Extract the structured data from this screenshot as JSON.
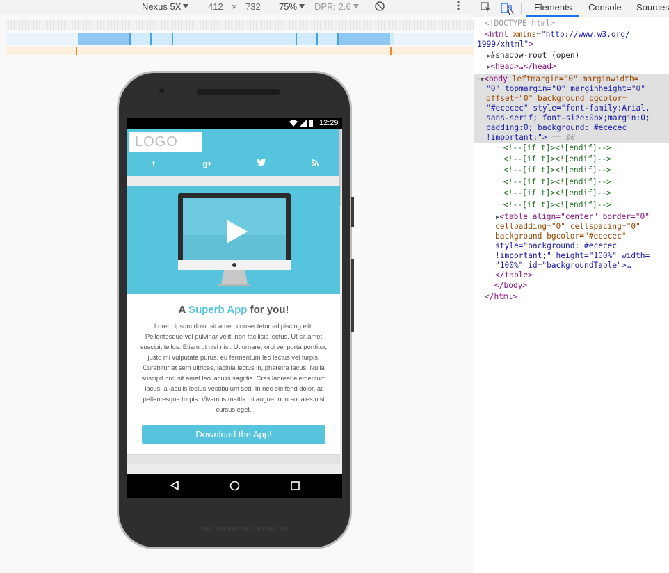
{
  "emulator": {
    "device": "Nexus 5X",
    "width": "412",
    "times": "×",
    "height": "732",
    "zoom": "75%",
    "dpr": "DPR: 2.6"
  },
  "phone": {
    "status_time": "12:29",
    "logo": "LOGO",
    "social": [
      "f",
      "g+",
      "twitter",
      "rss"
    ],
    "headline_pre": "A ",
    "headline_accent": "Superb App",
    "headline_post": " for you!",
    "body_text": "Lorem ipsum dolor sit amet, consectetur adipiscing elit. Pellentesque vel pulvinar velit, non facilisis lectus. Ut sit amet suscipit tellus. Etiam ut nisl nisl. Ut ornare, orci vel porta porttitor, justo mi vulputate purus, eu fermentum leo lectus vel turpis. Curabitur et sem ultrices, lacinia lectus in, pharetra lacus. Nulla suscipit orci sit amet leo iaculis sagittis. Cras laoreet elementum lacus, a iaculis lectus vestibulum sed. In nec eleifend dolor, at pellentesque turpis. Vivamus mattis mi augue, non sodales nisi cursus eget.",
    "cta": "Download the App!"
  },
  "devtools": {
    "tabs": [
      "Elements",
      "Console",
      "Sources"
    ],
    "active_tab": "Elements"
  },
  "tree": {
    "doctype": "<!DOCTYPE html>",
    "html_open": "<html",
    "xmlns_attr": "xmlns",
    "xmlns_val": "\"http://www.w3.org/",
    "xmlns_val2": "1999/xhtml\"",
    "shadow_root": "#shadow-root (open)",
    "head": "<head>…</head>",
    "body_tag": "<body",
    "body_l1_attrs": "leftmargin=\"0\" marginwidth=",
    "body_l2": "\"0\" topmargin=\"0\" marginheight=\"0\"",
    "body_l3": "offset=\"0\" background bgcolor=",
    "body_l4": "\"#ececec\" style=\"font-family:Arial,",
    "body_l5": "sans-serif; font-size:0px;margin:0;",
    "body_l6": "padding:0; background: #ececec",
    "body_l7": "!important;\">",
    "eq_dollar": " == $0",
    "comment": "<!--[if t]><![endif]-->",
    "table_l1": "<table align=\"center\" border=\"0\"",
    "table_l2": "cellpadding=\"0\" cellspacing=\"0\"",
    "table_l3": "background bgcolor=\"#ececec\"",
    "table_l4": "style=\"background: #ececec",
    "table_l5": "!important;\" height=\"100%\" width=",
    "table_l6": "\"100%\" id=\"backgroundTable\">…",
    "table_close": "</table>",
    "body_close": "</body>",
    "html_close": "</html>"
  },
  "colors": {
    "brand": "#56c4dc",
    "email_bg": "#ececec",
    "devtools_accent": "#1a73e8"
  }
}
